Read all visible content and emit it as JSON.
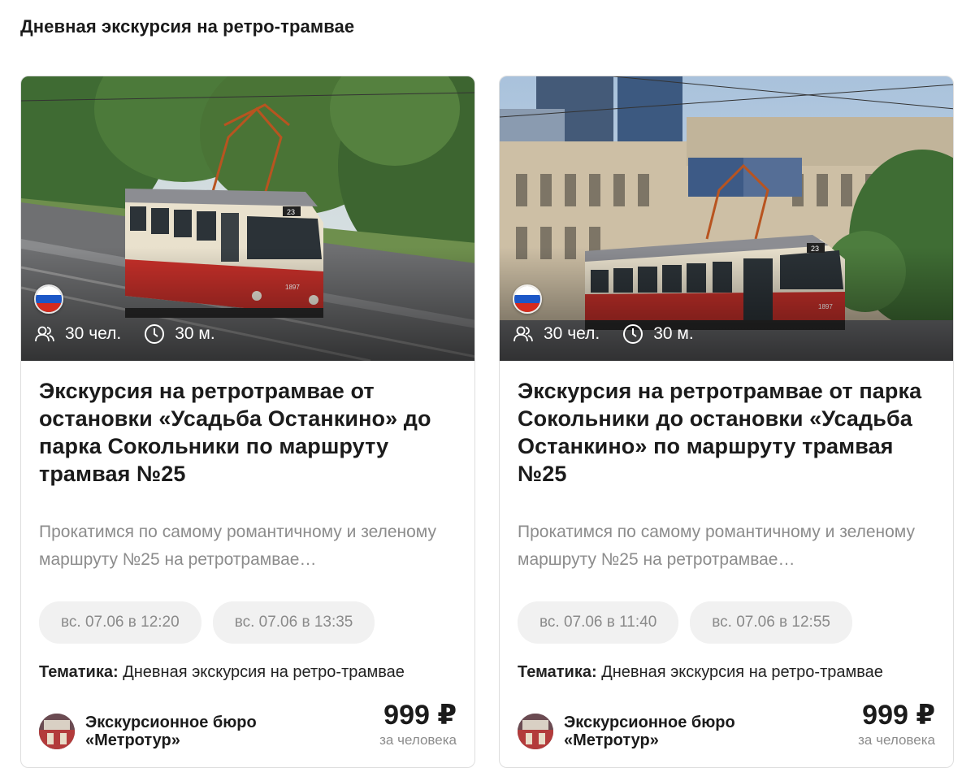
{
  "section": {
    "title": "Дневная экскурсия на ретро-трамвае"
  },
  "cards": [
    {
      "capacity": "30 чел.",
      "duration": "30 м.",
      "title": "Экскурсия на ретротрамвае от остановки «Усадьба Останкино» до парка Сокольники по маршруту трамвая №25",
      "description": "Прокатимся по самому романтичному и зеленому маршруту №25 на ретротрамвае…",
      "sessions": [
        "вс. 07.06 в 12:20",
        "вс. 07.06 в 13:35"
      ],
      "theme_label": "Тематика:",
      "theme_value": "Дневная экскурсия на ретро-трамвае",
      "organizer": "Экскурсионное бюро «Метротур»",
      "price": "999 ₽",
      "price_note": "за человека",
      "tram_number": "23",
      "tram_car": "1897"
    },
    {
      "capacity": "30 чел.",
      "duration": "30 м.",
      "title": "Экскурсия на ретротрамвае от парка Сокольники до остановки «Усадьба Останкино» по маршруту трамвая №25",
      "description": "Прокатимся по самому романтичному и зеленому маршруту №25 на ретротрамвае…",
      "sessions": [
        "вс. 07.06 в 11:40",
        "вс. 07.06 в 12:55"
      ],
      "theme_label": "Тематика:",
      "theme_value": "Дневная экскурсия на ретро-трамвае",
      "organizer": "Экскурсионное бюро «Метротур»",
      "price": "999 ₽",
      "price_note": "за человека",
      "tram_number": "23",
      "tram_car": "1897"
    }
  ],
  "colors": {
    "tram_red": "#c8302a",
    "tram_cream": "#e8e0cc",
    "chip_bg": "#f1f1f1"
  },
  "icons": {
    "capacity": "people-icon",
    "duration": "clock-icon",
    "flag": "russia-flag-icon"
  }
}
